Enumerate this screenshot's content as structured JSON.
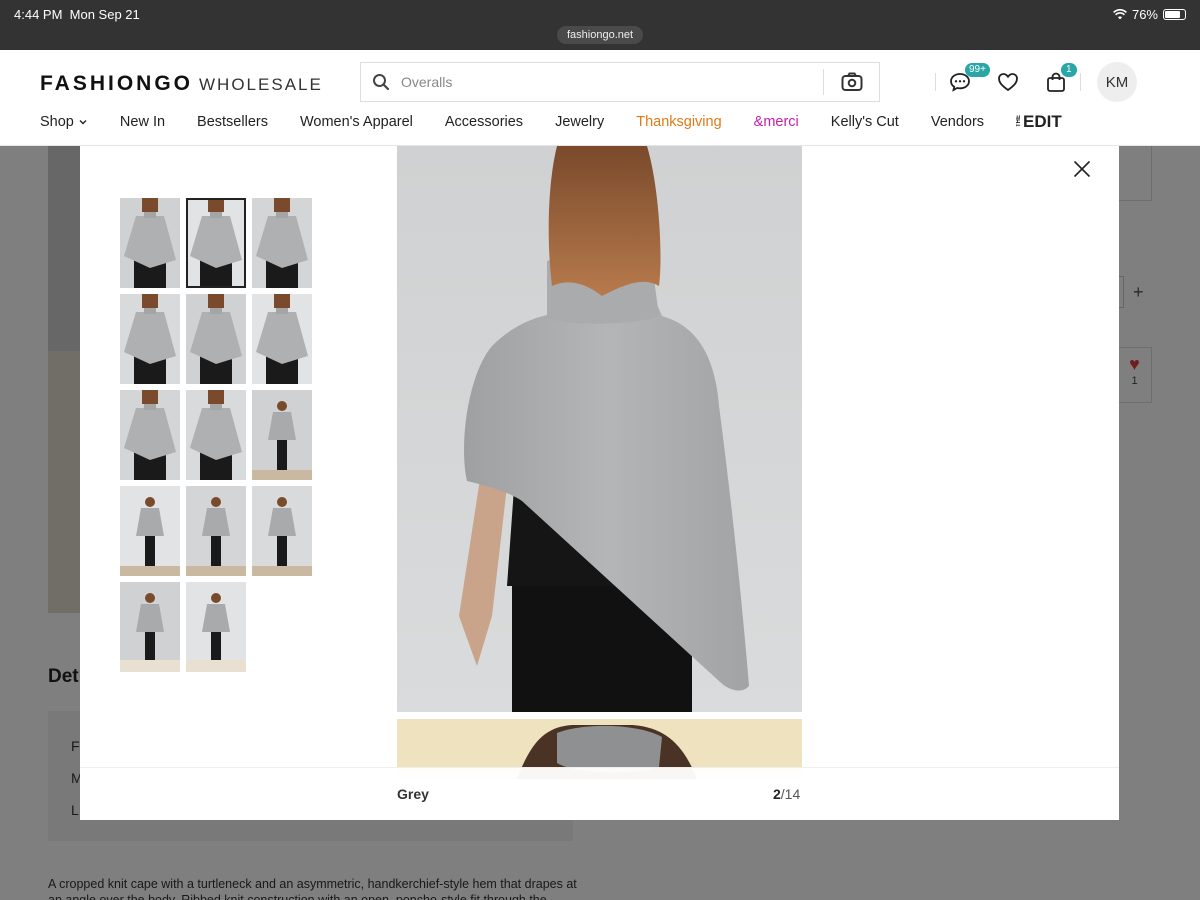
{
  "status_bar": {
    "time": "4:44 PM",
    "date": "Mon Sep 21",
    "url": "fashiongo.net",
    "battery": "76%"
  },
  "header": {
    "logo_brand": "FASHIONGO",
    "logo_suffix": "WHOLESALE",
    "search_placeholder": "Overalls",
    "messages_badge": "99+",
    "cart_badge": "1",
    "avatar_initials": "KM",
    "icons": [
      "search-icon",
      "camera-search-icon",
      "chat-icon",
      "heart-icon",
      "bag-icon"
    ]
  },
  "nav": {
    "shop": "Shop",
    "new_in": "New In",
    "bestsellers": "Bestsellers",
    "womens_apparel": "Women's Apparel",
    "accessories": "Accessories",
    "jewelry": "Jewelry",
    "thanksgiving": "Thanksgiving",
    "merci": "&merci",
    "kellys_cut": "Kelly's Cut",
    "vendors": "Vendors",
    "edit_prefix": "THE",
    "edit": "EDIT",
    "colors": {
      "thanksgiving": "#e07a16",
      "merci": "#c21fa8"
    }
  },
  "background_page": {
    "details_heading": "Det",
    "detail_letters": [
      "F",
      "M",
      "L"
    ],
    "description": "A cropped knit cape with a turtleneck and an asymmetric, handkerchief-style hem that drapes at an angle over the body. Ribbed knit construction with an open, poncho-style fit through the shoulders.",
    "like_count": "1"
  },
  "gallery": {
    "color_name": "Grey",
    "current_index": "2",
    "total": "/14",
    "selected_thumb": 2,
    "thumbnail_count": 14
  }
}
